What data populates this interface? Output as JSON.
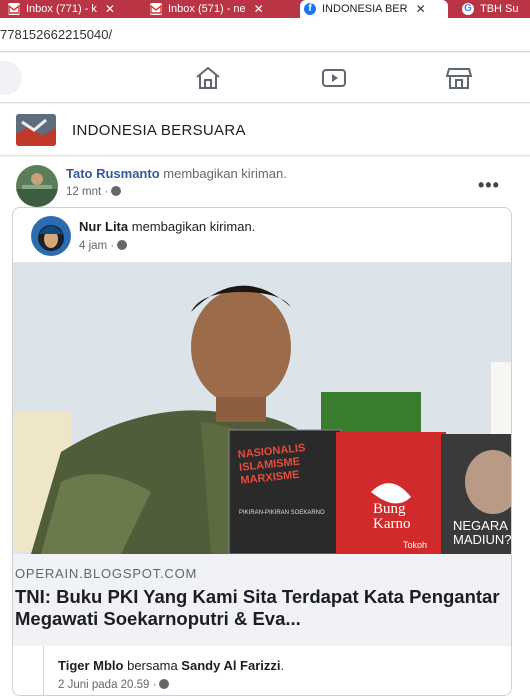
{
  "browser": {
    "tabs": [
      {
        "label": "Inbox (771) - k",
        "icon": "gmail-icon"
      },
      {
        "label": "Inbox (571) - ne",
        "icon": "gmail-icon"
      },
      {
        "label": "INDONESIA BER",
        "icon": "facebook-icon"
      },
      {
        "label": "TBH Su",
        "icon": "google-icon"
      }
    ],
    "url": "778152662215040/"
  },
  "nav": {
    "icons": [
      "home-icon",
      "video-icon",
      "marketplace-icon"
    ]
  },
  "group": {
    "name": "INDONESIA BERSUARA"
  },
  "post": {
    "author": "Tato Rusmanto",
    "action": " membagikan kiriman.",
    "time": "12 mnt ·",
    "more": "•••",
    "shared": {
      "author": "Nur Lita",
      "action": " membagikan kiriman.",
      "time": "4 jam ·"
    },
    "photo": {
      "book1_title": "NASIONALIS ISLAMISME MARXISME",
      "book1_sub": "PIKIRAN-PIKIRAN SOEKARNO",
      "book2_title": "Bung Karno",
      "book2_sub": "Tokoh",
      "book3_title": "NEGARA MADIUN?"
    },
    "link": {
      "domain": "OPERAIN.BLOGSPOT.COM",
      "title": "TNI: Buku PKI Yang Kami Sita Terdapat Kata Pengantar Megawati Soekarnoputri & Eva..."
    },
    "tagged": {
      "name1": "Tiger Mblo",
      "middle": " bersama ",
      "name2": "Sandy Al Farizzi",
      "end": ".",
      "time": "2 Juni pada 20.59 ·"
    }
  },
  "colors": {
    "tabbar": "#b93444",
    "facebook_blue": "#1877f2",
    "link_blue": "#385898"
  }
}
